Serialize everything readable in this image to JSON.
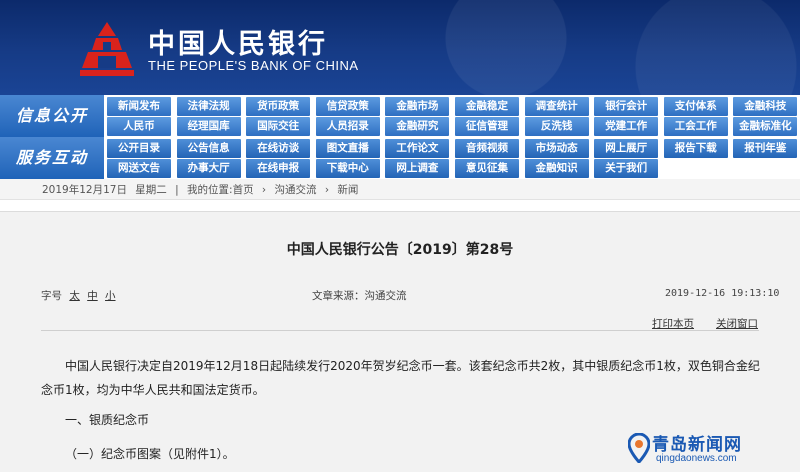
{
  "header": {
    "logo_cn": "中国人民银行",
    "logo_en": "THE PEOPLE'S BANK OF CHINA"
  },
  "nav": {
    "row1_label": "信息公开",
    "row2_label": "服务互动",
    "row1": [
      [
        "新闻发布",
        "法律法规",
        "货币政策",
        "信贷政策",
        "金融市场",
        "金融稳定",
        "调查统计",
        "银行会计",
        "支付体系",
        "金融科技"
      ],
      [
        "人民币",
        "经理国库",
        "国际交往",
        "人员招录",
        "金融研究",
        "征信管理",
        "反洗钱",
        "党建工作",
        "工会工作",
        "金融标准化"
      ]
    ],
    "row2": [
      [
        "公开目录",
        "公告信息",
        "在线访谈",
        "图文直播",
        "工作论文",
        "音频视频",
        "市场动态",
        "网上展厅",
        "报告下载",
        "报刊年鉴"
      ],
      [
        "网送文告",
        "办事大厅",
        "在线申报",
        "下载中心",
        "网上调查",
        "意见征集",
        "金融知识",
        "关于我们"
      ]
    ]
  },
  "breadcrumb": {
    "date": "2019年12月17日",
    "weekday": "星期二",
    "location_label": "我的位置:",
    "home": "首页",
    "sep": "›",
    "section": "沟通交流",
    "page": "新闻"
  },
  "article": {
    "title": "中国人民银行公告〔2019〕第28号",
    "font_size_label": "字号",
    "font_sizes": [
      "太",
      "中",
      "小"
    ],
    "source": "文章来源：沟通交流",
    "datetime": "2019-12-16  19:13:10",
    "print_label": "打印本页",
    "close_label": "关闭窗口",
    "para1": "中国人民银行决定自2019年12月18日起陆续发行2020年贺岁纪念币一套。该套纪念币共2枚，其中银质纪念币1枚，双色铜合金纪念币1枚，均为中华人民共和国法定货币。",
    "para2": "一、银质纪念币",
    "para3": "（一）纪念币图案（见附件1）。"
  },
  "watermark": {
    "name": "青岛新闻网",
    "url": "qingdaonews.com",
    "color": "#1a59b3"
  },
  "colors": {
    "header_bg": "#163b86",
    "nav_blue": "#2e6fc2",
    "emblem_red": "#d9231c"
  }
}
